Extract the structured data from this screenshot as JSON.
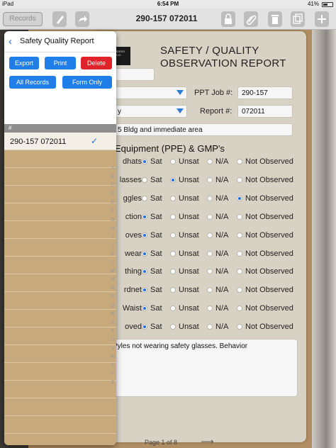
{
  "status": {
    "carrier": "iPad",
    "time": "6:54 PM",
    "battery": "41%"
  },
  "nav": {
    "records_label": "Records",
    "title": "290-157 072011"
  },
  "report": {
    "logo_text": "ODESS PLIC",
    "title_line1": "SAFETY / QUALITY",
    "title_line2": "OBSERVATION REPORT",
    "ppt_job_label": "PPT Job #:",
    "ppt_job_value": "290-157",
    "report_label": "Report #:",
    "report_value": "072011",
    "dropdown2_value": "y",
    "location_value": "5 Bldg and immediate area",
    "section_title": "Equipment (PPE) & GMP's",
    "options": [
      "Sat",
      "Unsat",
      "N/A",
      "Not Observed"
    ],
    "rows": [
      {
        "label": "dhats:",
        "selected": 0
      },
      {
        "label": "lasses:",
        "selected": 1
      },
      {
        "label": "ggles:",
        "selected": 3
      },
      {
        "label": "ction:",
        "selected": 0
      },
      {
        "label": "oves:",
        "selected": 0
      },
      {
        "label": "wear:",
        "selected": 0
      },
      {
        "label": "thing:",
        "selected": 0
      },
      {
        "label": "rdnet:",
        "selected": 0
      },
      {
        "label": "Waist:",
        "selected": 0
      },
      {
        "label": "oved:",
        "selected": 0
      }
    ],
    "comments": "Pyles not wearing safety glasses.  Behavior",
    "page_indicator": "Page 1 of 8"
  },
  "popover": {
    "title": "Safety Quality Report",
    "export_label": "Export",
    "print_label": "Print",
    "delete_label": "Delete",
    "all_records_label": "All Records",
    "form_only_label": "Form Only",
    "section_header": "#",
    "records": [
      {
        "name": "290-157 072011",
        "selected": true
      }
    ],
    "index_letters": [
      "A",
      "B",
      "C",
      "D",
      "E",
      "F",
      "G",
      "H",
      "I",
      "J",
      "K",
      "L",
      "M",
      "N",
      "O",
      "P",
      "Q",
      "R",
      "S",
      "T",
      "U",
      "V",
      "W",
      "X",
      "Y",
      "Z"
    ]
  },
  "colors": {
    "accent": "#1f7ee8",
    "delete": "#e0222a",
    "selected_radio": "#1f6fd9"
  }
}
